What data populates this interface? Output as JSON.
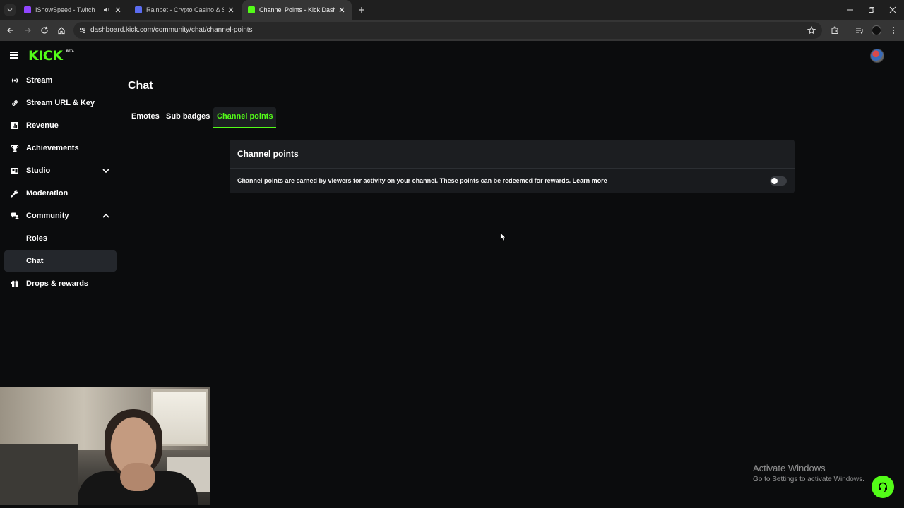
{
  "browser": {
    "tabs": [
      {
        "title": "IShowSpeed - Twitch",
        "favicon_color": "#9146ff",
        "active": false,
        "muted": true
      },
      {
        "title": "Rainbet - Crypto Casino & Sports",
        "favicon_color": "#5b6cf0",
        "active": false,
        "muted": false
      },
      {
        "title": "Channel Points - Kick Dashboard",
        "favicon_color": "#53fc18",
        "active": true,
        "muted": false
      }
    ],
    "url": "dashboard.kick.com/community/chat/channel-points"
  },
  "app": {
    "logo_text": "KICK",
    "logo_badge": "BETA",
    "accent_color": "#53fc18"
  },
  "sidebar": {
    "items": [
      {
        "label": "Stream",
        "icon": "broadcast-icon"
      },
      {
        "label": "Stream URL & Key",
        "icon": "link-icon"
      },
      {
        "label": "Revenue",
        "icon": "chart-icon"
      },
      {
        "label": "Achievements",
        "icon": "trophy-icon"
      },
      {
        "label": "Studio",
        "icon": "studio-icon",
        "expandable": true,
        "expanded": false
      },
      {
        "label": "Moderation",
        "icon": "wrench-icon"
      },
      {
        "label": "Community",
        "icon": "community-icon",
        "expandable": true,
        "expanded": true
      },
      {
        "label": "Roles",
        "sub": true
      },
      {
        "label": "Chat",
        "sub": true,
        "active": true
      },
      {
        "label": "Drops & rewards",
        "icon": "gift-icon"
      }
    ]
  },
  "main": {
    "title": "Chat",
    "tabs": [
      {
        "label": "Emotes",
        "active": false
      },
      {
        "label": "Sub badges",
        "active": false
      },
      {
        "label": "Channel points",
        "active": true
      }
    ],
    "card": {
      "title": "Channel points",
      "description": "Channel points are earned by viewers for activity on your channel. These points can be redeemed for rewards.",
      "learn_more": "Learn more",
      "toggle_on": false
    }
  },
  "overlay": {
    "activate_title": "Activate Windows",
    "activate_sub": "Go to Settings to activate Windows."
  }
}
